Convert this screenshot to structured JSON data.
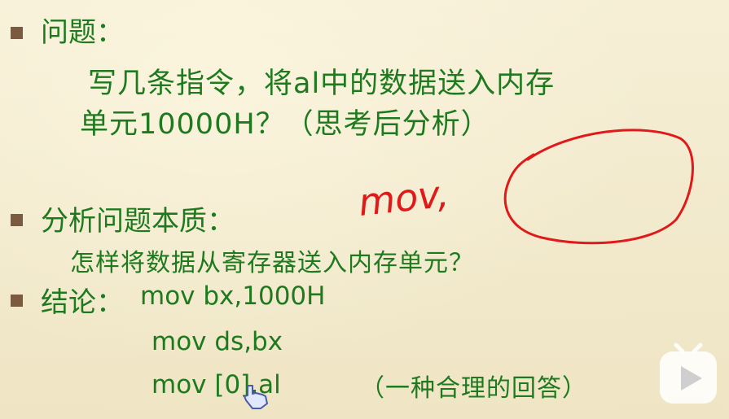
{
  "slide": {
    "q_title": "问题：",
    "q_line1": "写几条指令，将al中的数据送入内存",
    "q_line2": "单元10000H？（思考后分析）",
    "analysis_title": "分析问题本质：",
    "analysis_text": "怎样将数据从寄存器送入内存单元？",
    "conclusion_label": "结论：",
    "code_line1": "mov bx,1000H",
    "code_line2": "mov ds,bx",
    "code_line3": "mov [0],al",
    "note": "（一种合理的回答）"
  },
  "annotation": {
    "handwriting": "mov,",
    "ink_color": "#e01a1a"
  },
  "colors": {
    "text": "#1f7a1f",
    "bullet": "#7b5a3f",
    "background": "#f4ecd0"
  },
  "icons": {
    "play": "play-icon",
    "cursor": "hand-cursor-icon"
  }
}
